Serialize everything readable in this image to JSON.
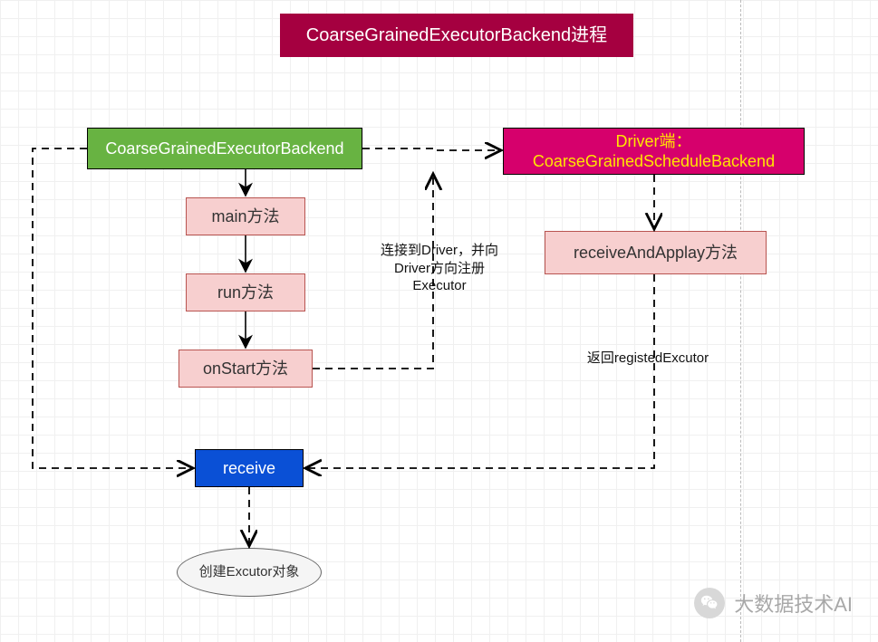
{
  "title": "CoarseGrainedExecutorBackend进程",
  "nodes": {
    "executor_backend": "CoarseGrainedExecutorBackend",
    "main_method": "main方法",
    "run_method": "run方法",
    "onstart_method": "onStart方法",
    "driver_side": "Driver端：\nCoarseGrainedScheduleBackend",
    "receive_and_apply": "receiveAndApplay方法",
    "receive": "receive",
    "create_executor": "创建Excutor对象"
  },
  "edge_labels": {
    "connect_register": "连接到Driver，并向\nDriver方向注册\nExecutor",
    "return_registed": "返回registedExcutor"
  },
  "watermark": "大数据技术AI"
}
